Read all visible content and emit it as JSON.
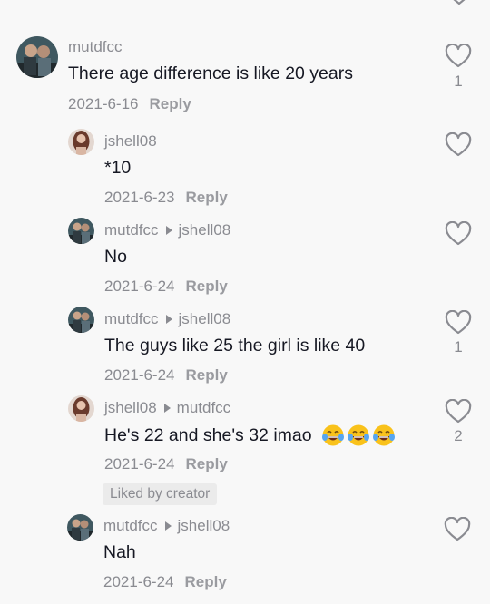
{
  "comments": [
    {
      "user": "mutdfcc",
      "reply_to": "",
      "text": "There age difference is like 20 years",
      "date": "2021-6-16",
      "reply_label": "Reply",
      "likes": "1"
    },
    {
      "user": "jshell08",
      "reply_to": "",
      "text": "*10",
      "date": "2021-6-23",
      "reply_label": "Reply",
      "likes": ""
    },
    {
      "user": "mutdfcc",
      "reply_to": "jshell08",
      "text": "No",
      "date": "2021-6-24",
      "reply_label": "Reply",
      "likes": ""
    },
    {
      "user": "mutdfcc",
      "reply_to": "jshell08",
      "text": "The guys like 25 the girl is like 40",
      "date": "2021-6-24",
      "reply_label": "Reply",
      "likes": "1"
    },
    {
      "user": "jshell08",
      "reply_to": "mutdfcc",
      "text": "He's 22 and she's 32 imao",
      "date": "2021-6-24",
      "reply_label": "Reply",
      "likes": "2",
      "liked_by_creator": "Liked by creator",
      "emoji": "tears-of-joy-emoji"
    },
    {
      "user": "mutdfcc",
      "reply_to": "jshell08",
      "text": "Nah",
      "date": "2021-6-24",
      "reply_label": "Reply",
      "likes": ""
    }
  ],
  "icons": {
    "like": "heart-outline-icon",
    "reply_arrow": "triangle-right-icon"
  },
  "colors": {
    "background": "#f8f8f8",
    "primary_text": "#161823",
    "secondary_text": "#8a8b91"
  }
}
